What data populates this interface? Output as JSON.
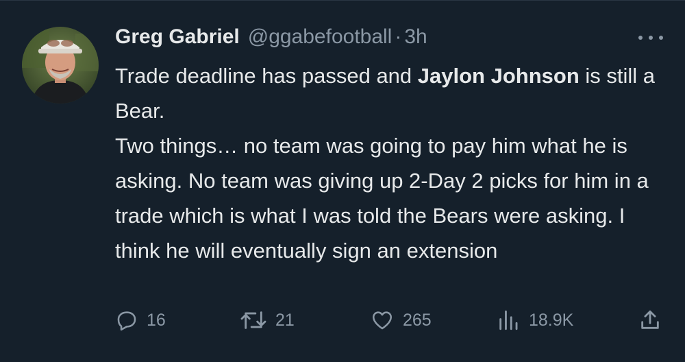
{
  "author": {
    "name": "Greg Gabriel",
    "handle": "@ggabefootball",
    "separator": "·",
    "time": "3h"
  },
  "tweet": {
    "seg1": "Trade deadline has passed and ",
    "seg2": "Jaylon Johnson",
    "seg3": " is still a Bear.",
    "line2": "Two things… no team was going to pay him what he is asking. No team was giving up 2-Day 2 picks for him in a trade which is what I was told the Bears were asking. I think he will eventually sign an extension"
  },
  "actions": {
    "replies": "16",
    "retweets": "21",
    "likes": "265",
    "views": "18.9K"
  },
  "icons": {
    "more": "more-icon",
    "reply": "reply-icon",
    "retweet": "retweet-icon",
    "like": "heart-icon",
    "views": "views-icon",
    "share": "share-icon"
  },
  "colors": {
    "background": "#15202b",
    "text": "#e7e9ea",
    "muted": "#8b98a5"
  }
}
